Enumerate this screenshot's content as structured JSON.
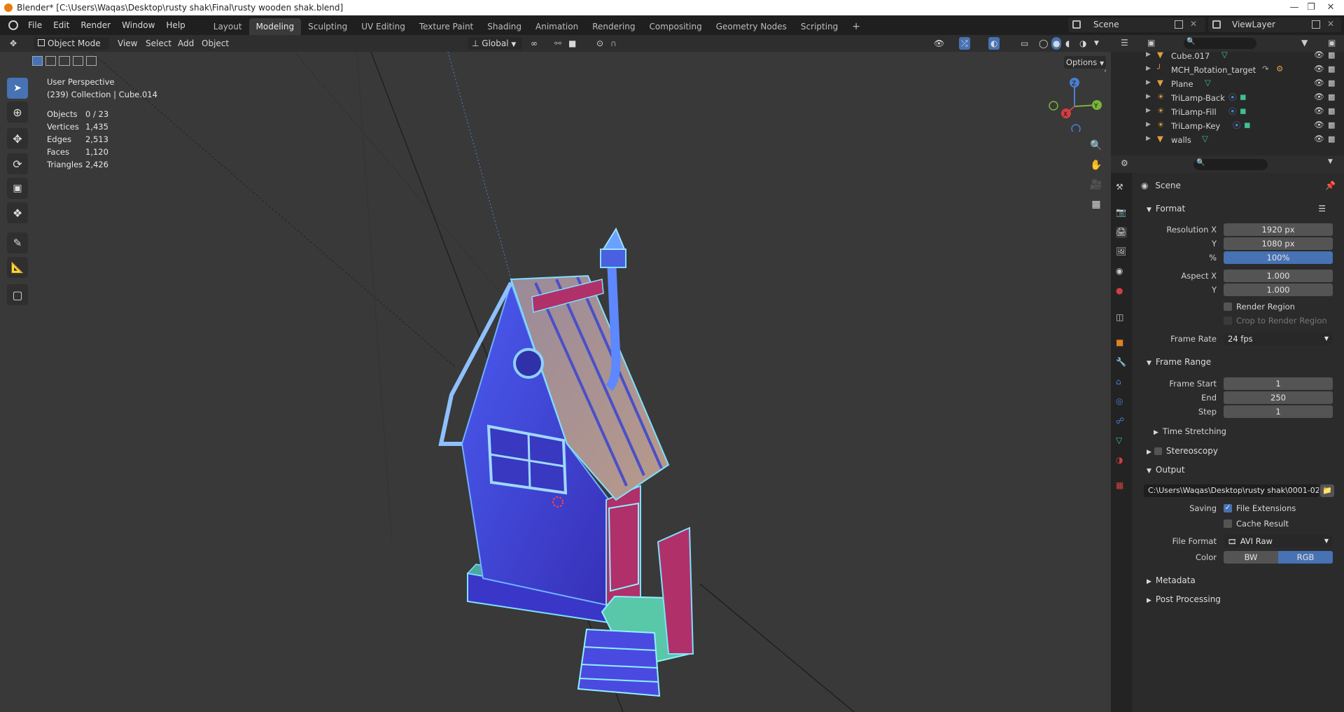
{
  "window": {
    "title": "Blender* [C:\\Users\\Waqas\\Desktop\\rusty shak\\Final\\rusty wooden shak.blend]"
  },
  "menus": [
    "File",
    "Edit",
    "Render",
    "Window",
    "Help"
  ],
  "workspaces": [
    "Layout",
    "Modeling",
    "Sculpting",
    "UV Editing",
    "Texture Paint",
    "Shading",
    "Animation",
    "Rendering",
    "Compositing",
    "Geometry Nodes",
    "Scripting"
  ],
  "active_workspace": "Modeling",
  "scene_selector": {
    "value": "Scene"
  },
  "viewlayer_selector": {
    "value": "ViewLayer"
  },
  "viewport_header": {
    "mode": "Object Mode",
    "menus": [
      "View",
      "Select",
      "Add",
      "Object"
    ],
    "orientation": "Global",
    "options_label": "Options"
  },
  "overlay": {
    "view_name": "User Perspective",
    "collection_line": "(239) Collection | Cube.014",
    "stats": [
      {
        "label": "Objects",
        "value": "0 / 23"
      },
      {
        "label": "Vertices",
        "value": "1,435"
      },
      {
        "label": "Edges",
        "value": "2,513"
      },
      {
        "label": "Faces",
        "value": "1,120"
      },
      {
        "label": "Triangles",
        "value": "2,426"
      }
    ]
  },
  "gizmo": {
    "x": "X",
    "y": "Y",
    "z": "Z"
  },
  "outliner": {
    "items": [
      {
        "name": "Cube.017",
        "type": "mesh"
      },
      {
        "name": "MCH_Rotation_target",
        "type": "armature"
      },
      {
        "name": "Plane",
        "type": "mesh"
      },
      {
        "name": "TriLamp-Back",
        "type": "light"
      },
      {
        "name": "TriLamp-Fill",
        "type": "light"
      },
      {
        "name": "TriLamp-Key",
        "type": "light"
      },
      {
        "name": "walls",
        "type": "mesh"
      }
    ]
  },
  "properties": {
    "context": "Scene",
    "format": {
      "header": "Format",
      "resolution_x_label": "Resolution X",
      "resolution_x": "1920 px",
      "resolution_y_label": "Y",
      "resolution_y": "1080 px",
      "percent_label": "%",
      "percent": "100%",
      "aspect_x_label": "Aspect X",
      "aspect_x": "1.000",
      "aspect_y_label": "Y",
      "aspect_y": "1.000",
      "render_region": "Render Region",
      "crop_region": "Crop to Render Region",
      "frame_rate_label": "Frame Rate",
      "frame_rate": "24 fps"
    },
    "frame_range": {
      "header": "Frame Range",
      "start_label": "Frame Start",
      "start": "1",
      "end_label": "End",
      "end": "250",
      "step_label": "Step",
      "step": "1",
      "time_stretching": "Time Stretching"
    },
    "stereoscopy": "Stereoscopy",
    "output": {
      "header": "Output",
      "path": "C:\\Users\\Waqas\\Desktop\\rusty shak\\0001-025...",
      "saving_label": "Saving",
      "file_extensions": "File Extensions",
      "cache_result": "Cache Result",
      "file_format_label": "File Format",
      "file_format": "AVI Raw",
      "color_label": "Color",
      "color_bw": "BW",
      "color_rgb": "RGB"
    },
    "metadata": "Metadata",
    "post_processing": "Post Processing"
  },
  "colors": {
    "accent": "#4772b3",
    "viewport_bg": "#393939",
    "mesh_icon": "#e0a040",
    "data_icon": "#3fbf8f"
  }
}
